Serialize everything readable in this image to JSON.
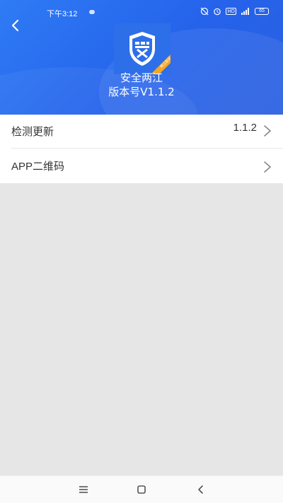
{
  "status_bar": {
    "time": "下午3:12",
    "battery": "65",
    "network_label": "HD"
  },
  "header": {
    "app_name": "安全两江",
    "version_text": "版本号V1.1.2",
    "logo_badge": "两江新区"
  },
  "settings": {
    "items": [
      {
        "label": "检测更新",
        "value": "1.1.2"
      },
      {
        "label": "APP二维码",
        "value": ""
      }
    ]
  },
  "colors": {
    "header_blue": "#2563eb",
    "logo_orange": "#f5a623"
  },
  "icons": {
    "back": "back-arrow-icon",
    "chevron": "chevron-right-icon",
    "nav_menu": "menu-icon",
    "nav_home": "home-icon",
    "nav_back": "nav-back-icon"
  }
}
